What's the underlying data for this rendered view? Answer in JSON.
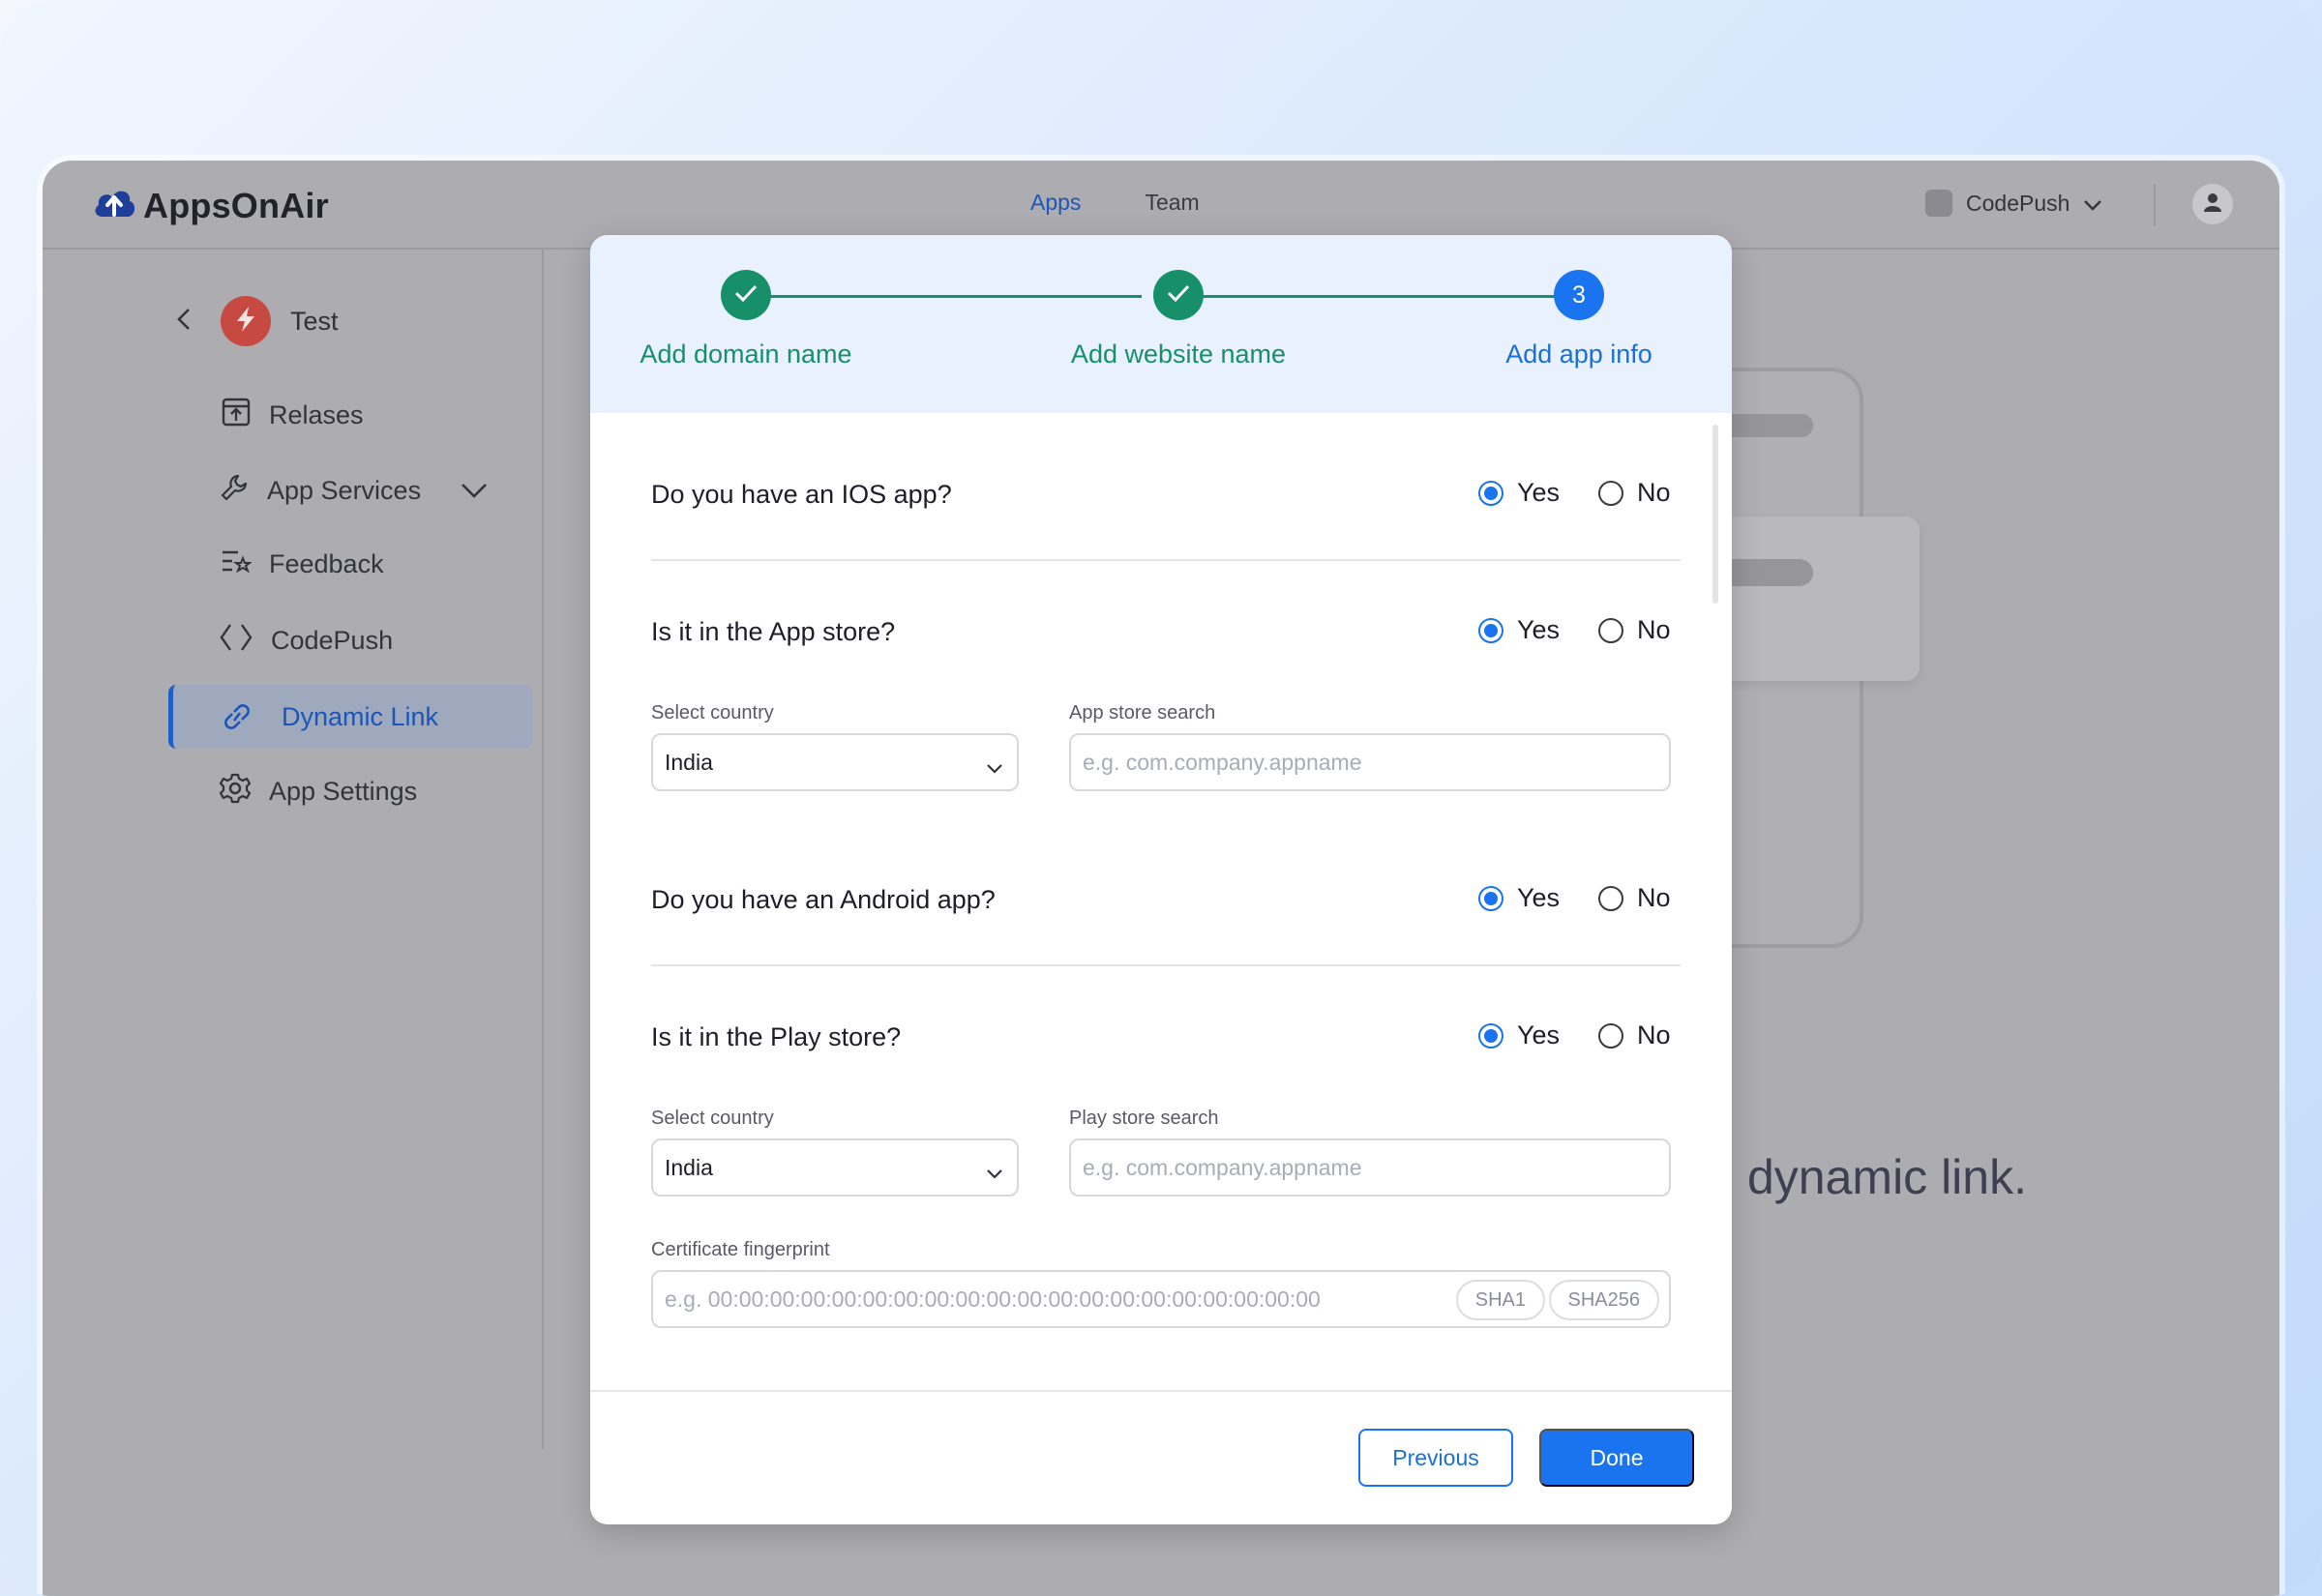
{
  "app": {
    "brand": "AppsOnAir",
    "nav": [
      "Apps",
      "Team"
    ],
    "project_selector": "CodePush"
  },
  "sidebar": {
    "app_name": "Test",
    "items": [
      {
        "label": "Relases",
        "icon": "release-box-icon"
      },
      {
        "label": "App Services",
        "icon": "wrench-icon"
      },
      {
        "label": "Feedback",
        "icon": "feedback-list-icon"
      },
      {
        "label": "CodePush",
        "icon": "code-brackets-icon"
      },
      {
        "label": "Dynamic Link",
        "icon": "link-icon",
        "active": true
      },
      {
        "label": "App Settings",
        "icon": "gear-icon"
      }
    ]
  },
  "background": {
    "text": "dynamic link."
  },
  "modal": {
    "steps": [
      {
        "label": "Add domain name",
        "state": "done"
      },
      {
        "label": "Add website name",
        "state": "done"
      },
      {
        "label": "Add app info",
        "state": "current",
        "number": "3"
      }
    ],
    "questions": {
      "ios": "Do you have an IOS app?",
      "appstore": "Is it in the App store?",
      "android": "Do you have an Android app?",
      "playstore": "Is it in the Play store?"
    },
    "radio": {
      "yes": "Yes",
      "no": "No"
    },
    "ios_section": {
      "country_label": "Select country",
      "country_value": "India",
      "search_label": "App store search",
      "search_placeholder": "e.g. com.company.appname"
    },
    "android_section": {
      "country_label": "Select country",
      "country_value": "India",
      "search_label": "Play store search",
      "search_placeholder": "e.g. com.company.appname",
      "fingerprint_label": "Certificate fingerprint",
      "fingerprint_placeholder": "e.g. 00:00:00:00:00:00:00:00:00:00:00:00:00:00:00:00:00:00:00:00",
      "sha1": "SHA1",
      "sha256": "SHA256"
    },
    "buttons": {
      "previous": "Previous",
      "done": "Done"
    }
  },
  "colors": {
    "primary": "#1a74f0",
    "success": "#17906a",
    "brand_red": "#c64a42"
  }
}
